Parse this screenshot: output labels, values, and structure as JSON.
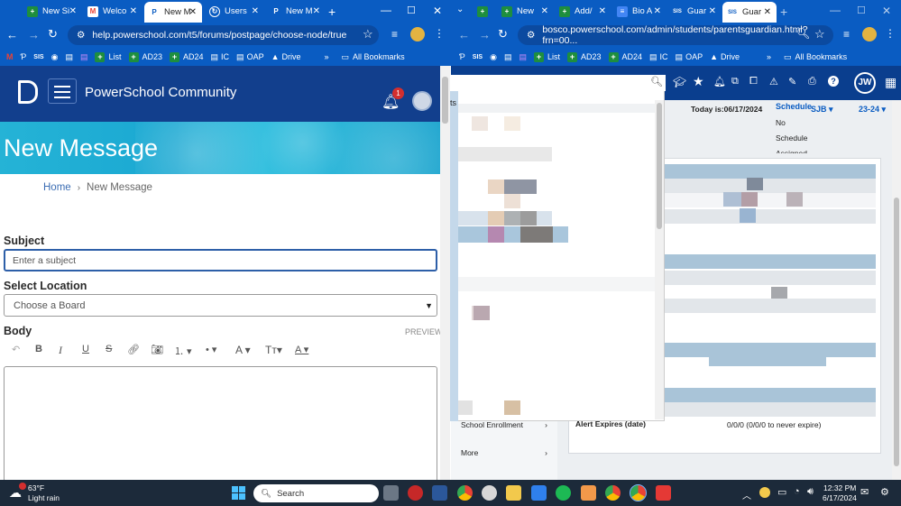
{
  "left_window": {
    "tabs": [
      {
        "label": "New Si",
        "active": false
      },
      {
        "label": "Welco",
        "active": false
      },
      {
        "label": "New M",
        "active": true
      },
      {
        "label": "Users",
        "active": false
      },
      {
        "label": "New M",
        "active": false
      }
    ],
    "url": "help.powerschool.com/t5/forums/postpage/choose-node/true",
    "bookmarks": [
      "SIS",
      "List",
      "AD23",
      "AD24",
      "IC",
      "OAP",
      "Drive"
    ],
    "all_bookmarks": "All Bookmarks"
  },
  "right_window": {
    "tabs": [
      {
        "label": "New",
        "active": false
      },
      {
        "label": "Add/",
        "active": false
      },
      {
        "label": "Bio A",
        "active": false
      },
      {
        "label": "Guar",
        "active": false
      },
      {
        "label": "Guar",
        "active": true
      }
    ],
    "url": "bosco.powerschool.com/admin/students/parentsguardian.html?frn=00...",
    "bookmarks": [
      "SIS",
      "List",
      "AD23",
      "AD24",
      "IC",
      "OAP",
      "Drive"
    ],
    "all_bookmarks": "All Bookmarks"
  },
  "community": {
    "title": "PowerSchool Community",
    "notification_count": "1",
    "banner_title": "New Message",
    "breadcrumb_home": "Home",
    "breadcrumb_current": "New Message",
    "subject_label": "Subject",
    "subject_placeholder": "Enter a subject",
    "location_label": "Select Location",
    "location_value": "Choose a Board",
    "body_label": "Body",
    "preview_label": "PREVIEW"
  },
  "sis": {
    "avatar": "JW",
    "today_label": "Today is:06/17/2024",
    "schedule_label": "Schedule",
    "school": "SJB",
    "term": "23-24",
    "no_label": "No",
    "schedule2": "Schedule",
    "assigned": "Assigned",
    "partial_text": "ts",
    "sidebar_items": [
      "School Enrollment",
      "More"
    ],
    "alert_label": "Alert Expires (date)",
    "alert_value": "0/0/0 (0/0/0 to never expire)"
  },
  "taskbar": {
    "weather_temp": "63°F",
    "weather_desc": "Light rain",
    "search_label": "Search",
    "time": "12:32 PM",
    "date": "6/17/2024"
  }
}
